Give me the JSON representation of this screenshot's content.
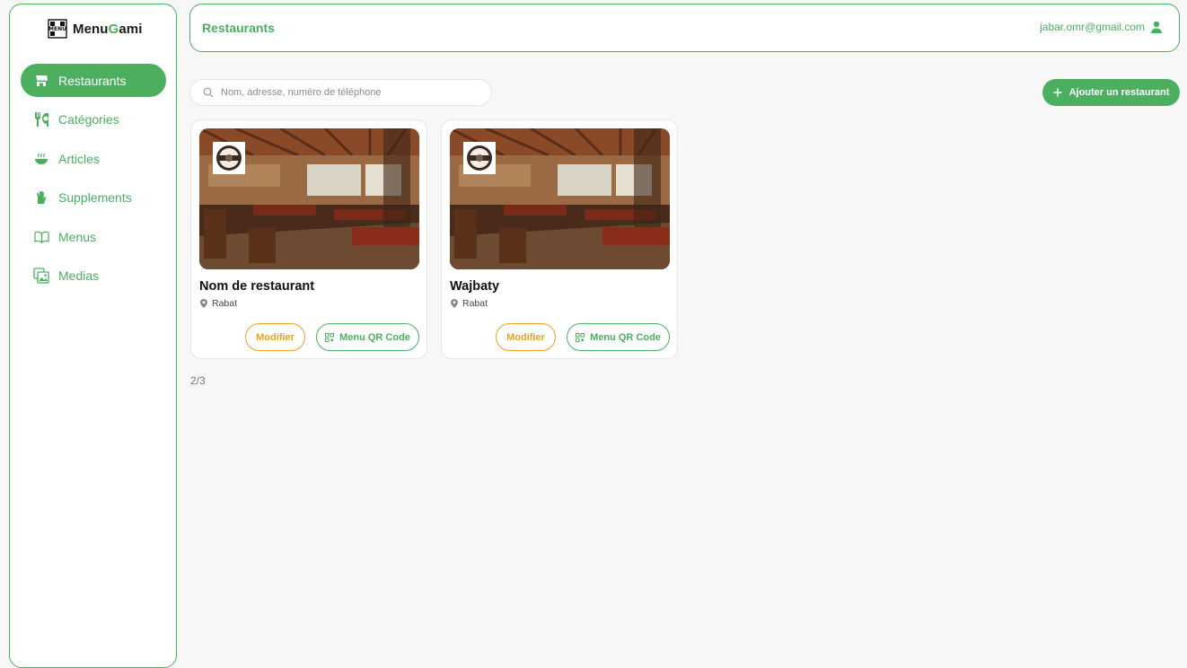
{
  "brand": {
    "name_part1": "Menu",
    "name_g": "G",
    "name_part2": "ami"
  },
  "sidebar": {
    "items": [
      {
        "label": "Restaurants",
        "icon": "store-icon",
        "active": true
      },
      {
        "label": "Catégories",
        "icon": "utensils-icon",
        "active": false
      },
      {
        "label": "Articles",
        "icon": "bowl-icon",
        "active": false
      },
      {
        "label": "Supplements",
        "icon": "hand-icon",
        "active": false
      },
      {
        "label": "Menus",
        "icon": "book-icon",
        "active": false
      },
      {
        "label": "Medias",
        "icon": "images-icon",
        "active": false
      }
    ]
  },
  "header": {
    "title": "Restaurants",
    "user_email": "jabar.omr@gmail.com"
  },
  "search": {
    "placeholder": "Nom, adresse, numéro de téléphone"
  },
  "toolbar": {
    "add_label": "Ajouter un restaurant"
  },
  "restaurants": [
    {
      "name": "Nom de restaurant",
      "city": "Rabat",
      "edit_label": "Modifier",
      "qr_label": "Menu QR Code"
    },
    {
      "name": "Wajbaty",
      "city": "Rabat",
      "edit_label": "Modifier",
      "qr_label": "Menu QR Code"
    }
  ],
  "pagination": {
    "text": "2/3"
  },
  "colors": {
    "accent": "#4caf60",
    "edit": "#f0a020",
    "background": "#f7f7f7"
  }
}
